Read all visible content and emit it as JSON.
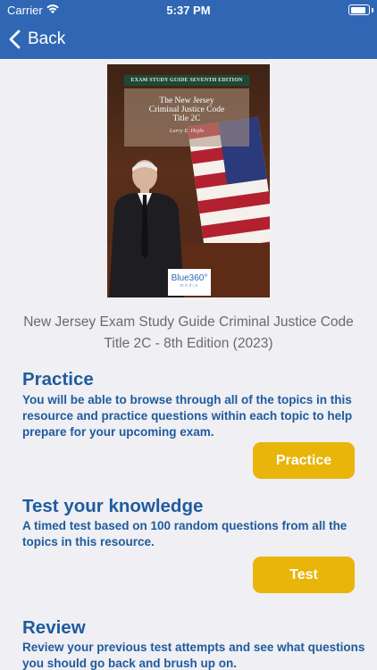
{
  "status_bar": {
    "carrier": "Carrier",
    "time": "5:37 PM",
    "battery_level": 0.9
  },
  "nav": {
    "back_label": "Back"
  },
  "cover": {
    "band_text": "EXAM STUDY GUIDE SEVENTH EDITION",
    "title_line1": "The New Jersey",
    "title_line2": "Criminal Justice Code",
    "title_line3": "Title 2C",
    "author": "Larry E. Hojlo",
    "logo_main": "Blue360°",
    "logo_sub": "media"
  },
  "book_title": "New Jersey Exam Study Guide Criminal Justice Code Title 2C - 8th Edition (2023)",
  "sections": {
    "practice": {
      "heading": "Practice",
      "description": "You will be able to browse through all of the topics in this resource and practice questions within each topic to help prepare for your upcoming exam.",
      "button_label": "Practice"
    },
    "test": {
      "heading": "Test your knowledge",
      "description": "A timed test based on 100 random questions from all the topics in this resource.",
      "button_label": "Test"
    },
    "review": {
      "heading": "Review",
      "description": "Review your previous test attempts and see what questions you should go back and brush up on."
    }
  },
  "colors": {
    "nav_bar": "#2f67b4",
    "accent_text": "#1f5b9d",
    "button": "#e9b50a",
    "background": "#efeff4"
  }
}
